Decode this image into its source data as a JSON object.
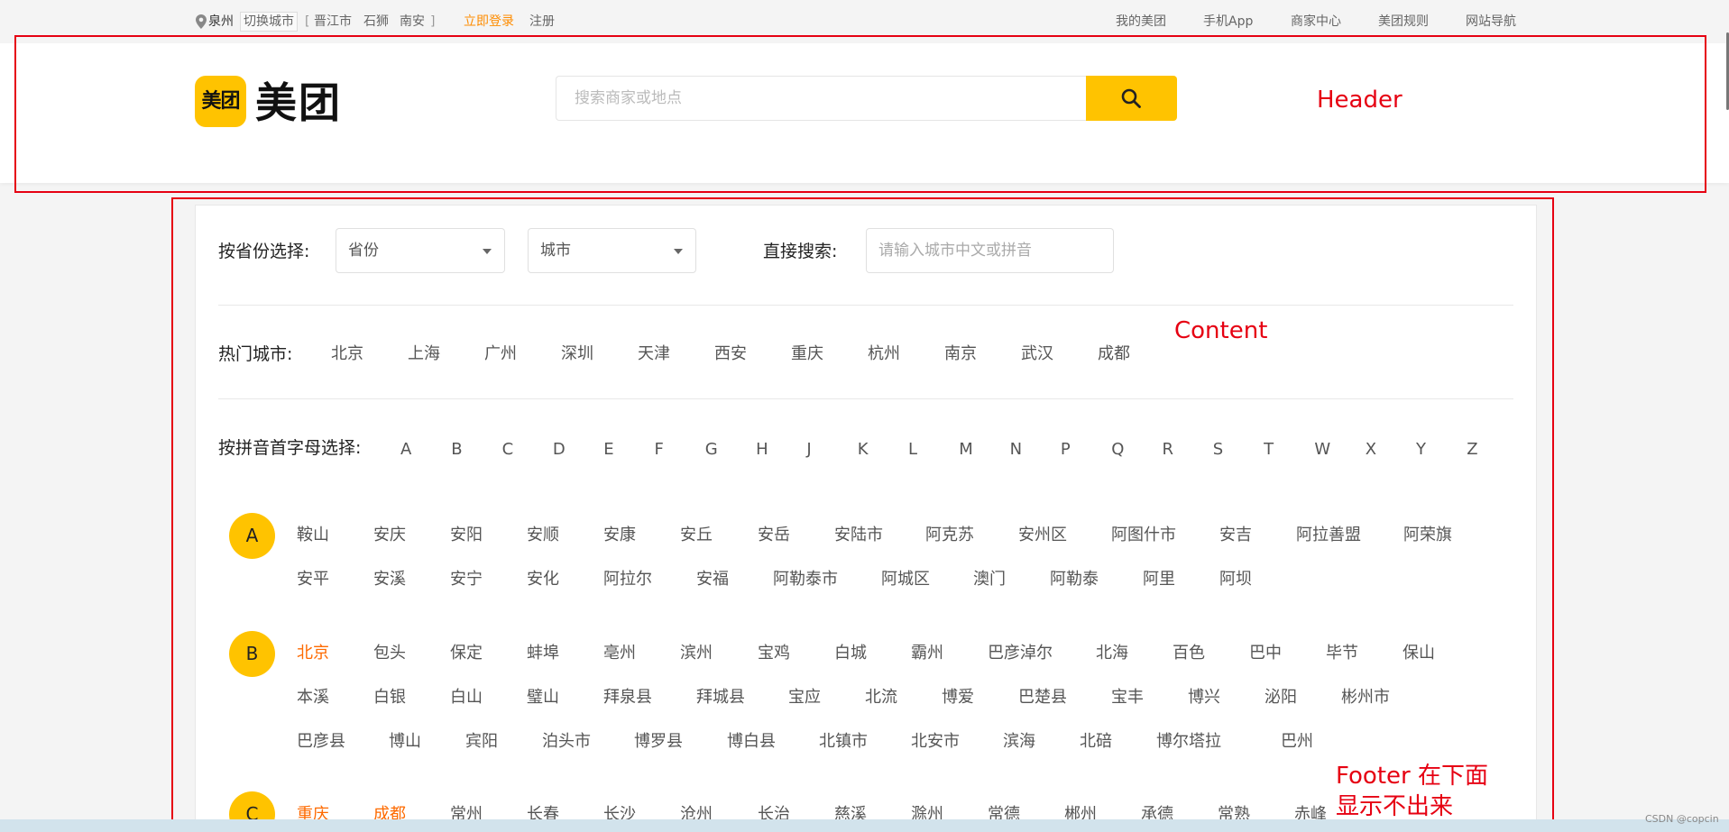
{
  "topbar": {
    "city": "泉州",
    "switch_city": "切换城市",
    "bracket_open": "[",
    "nearby": [
      "晋江市",
      "石狮",
      "南安"
    ],
    "bracket_close": "]",
    "login": "立即登录",
    "register": "注册",
    "right_links": [
      "我的美团",
      "手机App",
      "商家中心",
      "美团规则",
      "网站导航"
    ]
  },
  "header": {
    "logo_mark": "美团",
    "logo_text": "美团",
    "search_placeholder": "搜索商家或地点"
  },
  "filters": {
    "province_label": "按省份选择:",
    "province_value": "省份",
    "city_value": "城市",
    "direct_label": "直接搜索:",
    "direct_placeholder": "请输入城市中文或拼音"
  },
  "hot": {
    "label": "热门城市:",
    "cities": [
      "北京",
      "上海",
      "广州",
      "深圳",
      "天津",
      "西安",
      "重庆",
      "杭州",
      "南京",
      "武汉",
      "成都"
    ]
  },
  "pinyin": {
    "label": "按拼音首字母选择:",
    "letters": [
      "A",
      "B",
      "C",
      "D",
      "E",
      "F",
      "G",
      "H",
      "J",
      "K",
      "L",
      "M",
      "N",
      "P",
      "Q",
      "R",
      "S",
      "T",
      "W",
      "X",
      "Y",
      "Z"
    ]
  },
  "groups": {
    "A": {
      "letter": "A",
      "row1": [
        "鞍山",
        "安庆",
        "安阳",
        "安顺",
        "安康",
        "安丘",
        "安岳",
        "安陆市",
        "阿克苏",
        "安州区",
        "阿图什市",
        "安吉",
        "阿拉善盟",
        "阿荣旗"
      ],
      "row2": [
        "安平",
        "安溪",
        "安宁",
        "安化",
        "阿拉尔",
        "安福",
        "阿勒泰市",
        "阿城区",
        "澳门",
        "阿勒泰",
        "阿里",
        "阿坝"
      ]
    },
    "B": {
      "letter": "B",
      "row1": [
        "北京",
        "包头",
        "保定",
        "蚌埠",
        "亳州",
        "滨州",
        "宝鸡",
        "白城",
        "霸州",
        "巴彦淖尔",
        "北海",
        "百色",
        "巴中",
        "毕节",
        "保山"
      ],
      "row2": [
        "本溪",
        "白银",
        "白山",
        "璧山",
        "拜泉县",
        "拜城县",
        "宝应",
        "北流",
        "博爱",
        "巴楚县",
        "宝丰",
        "博兴",
        "泌阳",
        "彬州市"
      ],
      "row3": [
        "巴彦县",
        "博山",
        "宾阳",
        "泊头市",
        "博罗县",
        "博白县",
        "北镇市",
        "北安市",
        "滨海",
        "北碚",
        "博尔塔拉",
        "巴州"
      ]
    },
    "C": {
      "letter": "C",
      "row1": [
        "重庆",
        "成都",
        "常州",
        "长春",
        "长沙",
        "沧州",
        "长治",
        "慈溪",
        "滁州",
        "常德",
        "郴州",
        "承德",
        "常熟",
        "赤峰"
      ]
    }
  },
  "annotations": {
    "header": "Header",
    "content": "Content",
    "footer_line1": "Footer 在下面",
    "footer_line2": "显示不出来"
  },
  "watermark": "CSDN @copcin",
  "colors": {
    "brand_yellow": "#ffc300",
    "highlight_orange": "#fe6a00",
    "annotation_red": "#e60012"
  }
}
